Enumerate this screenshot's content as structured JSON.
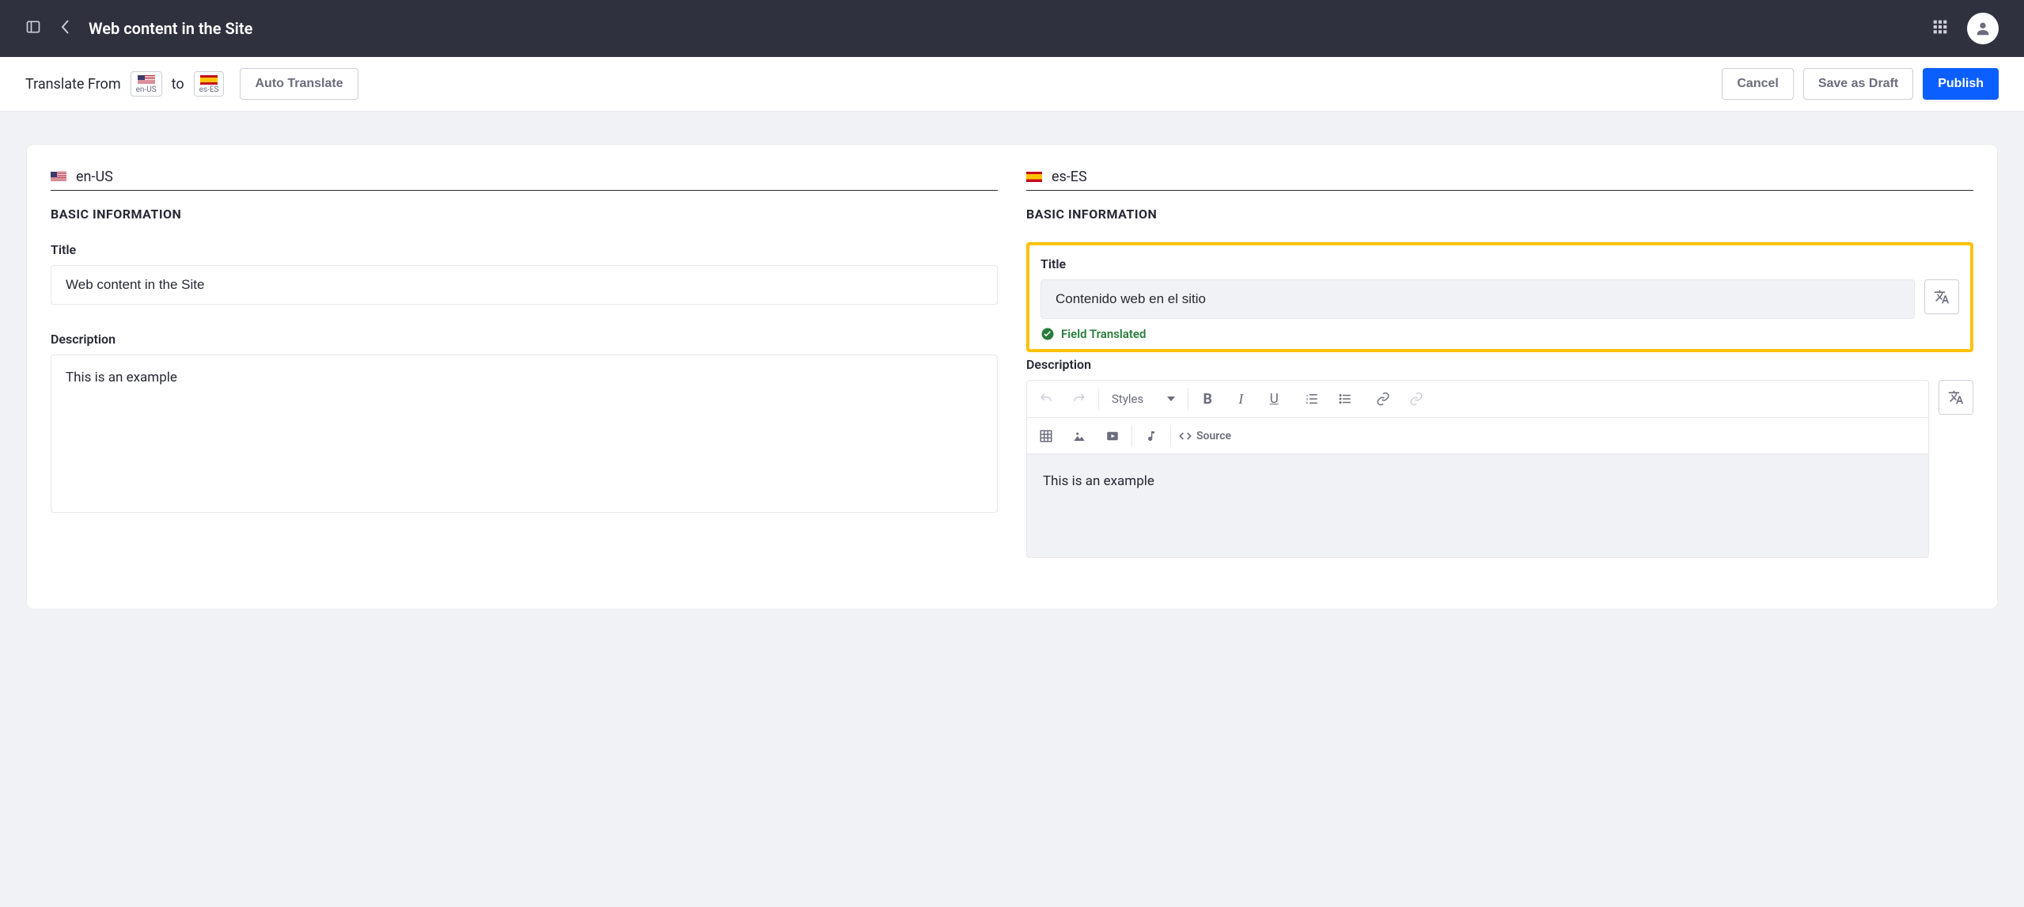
{
  "header": {
    "title": "Web content in the Site"
  },
  "toolbar": {
    "translate_from_label": "Translate From",
    "to_label": "to",
    "from_lang_code": "en-US",
    "to_lang_code": "es-ES",
    "auto_translate_label": "Auto Translate",
    "cancel_label": "Cancel",
    "save_draft_label": "Save as Draft",
    "publish_label": "Publish"
  },
  "source": {
    "lang_code": "en-US",
    "section_title": "BASIC INFORMATION",
    "title_label": "Title",
    "title_value": "Web content in the Site",
    "description_label": "Description",
    "description_value": "This is an example"
  },
  "target": {
    "lang_code": "es-ES",
    "section_title": "BASIC INFORMATION",
    "title_label": "Title",
    "title_value": "Contenido web en el sitio",
    "translated_status": "Field Translated",
    "description_label": "Description",
    "description_value": "This is an example",
    "editor": {
      "styles_label": "Styles",
      "source_label": "Source"
    }
  }
}
